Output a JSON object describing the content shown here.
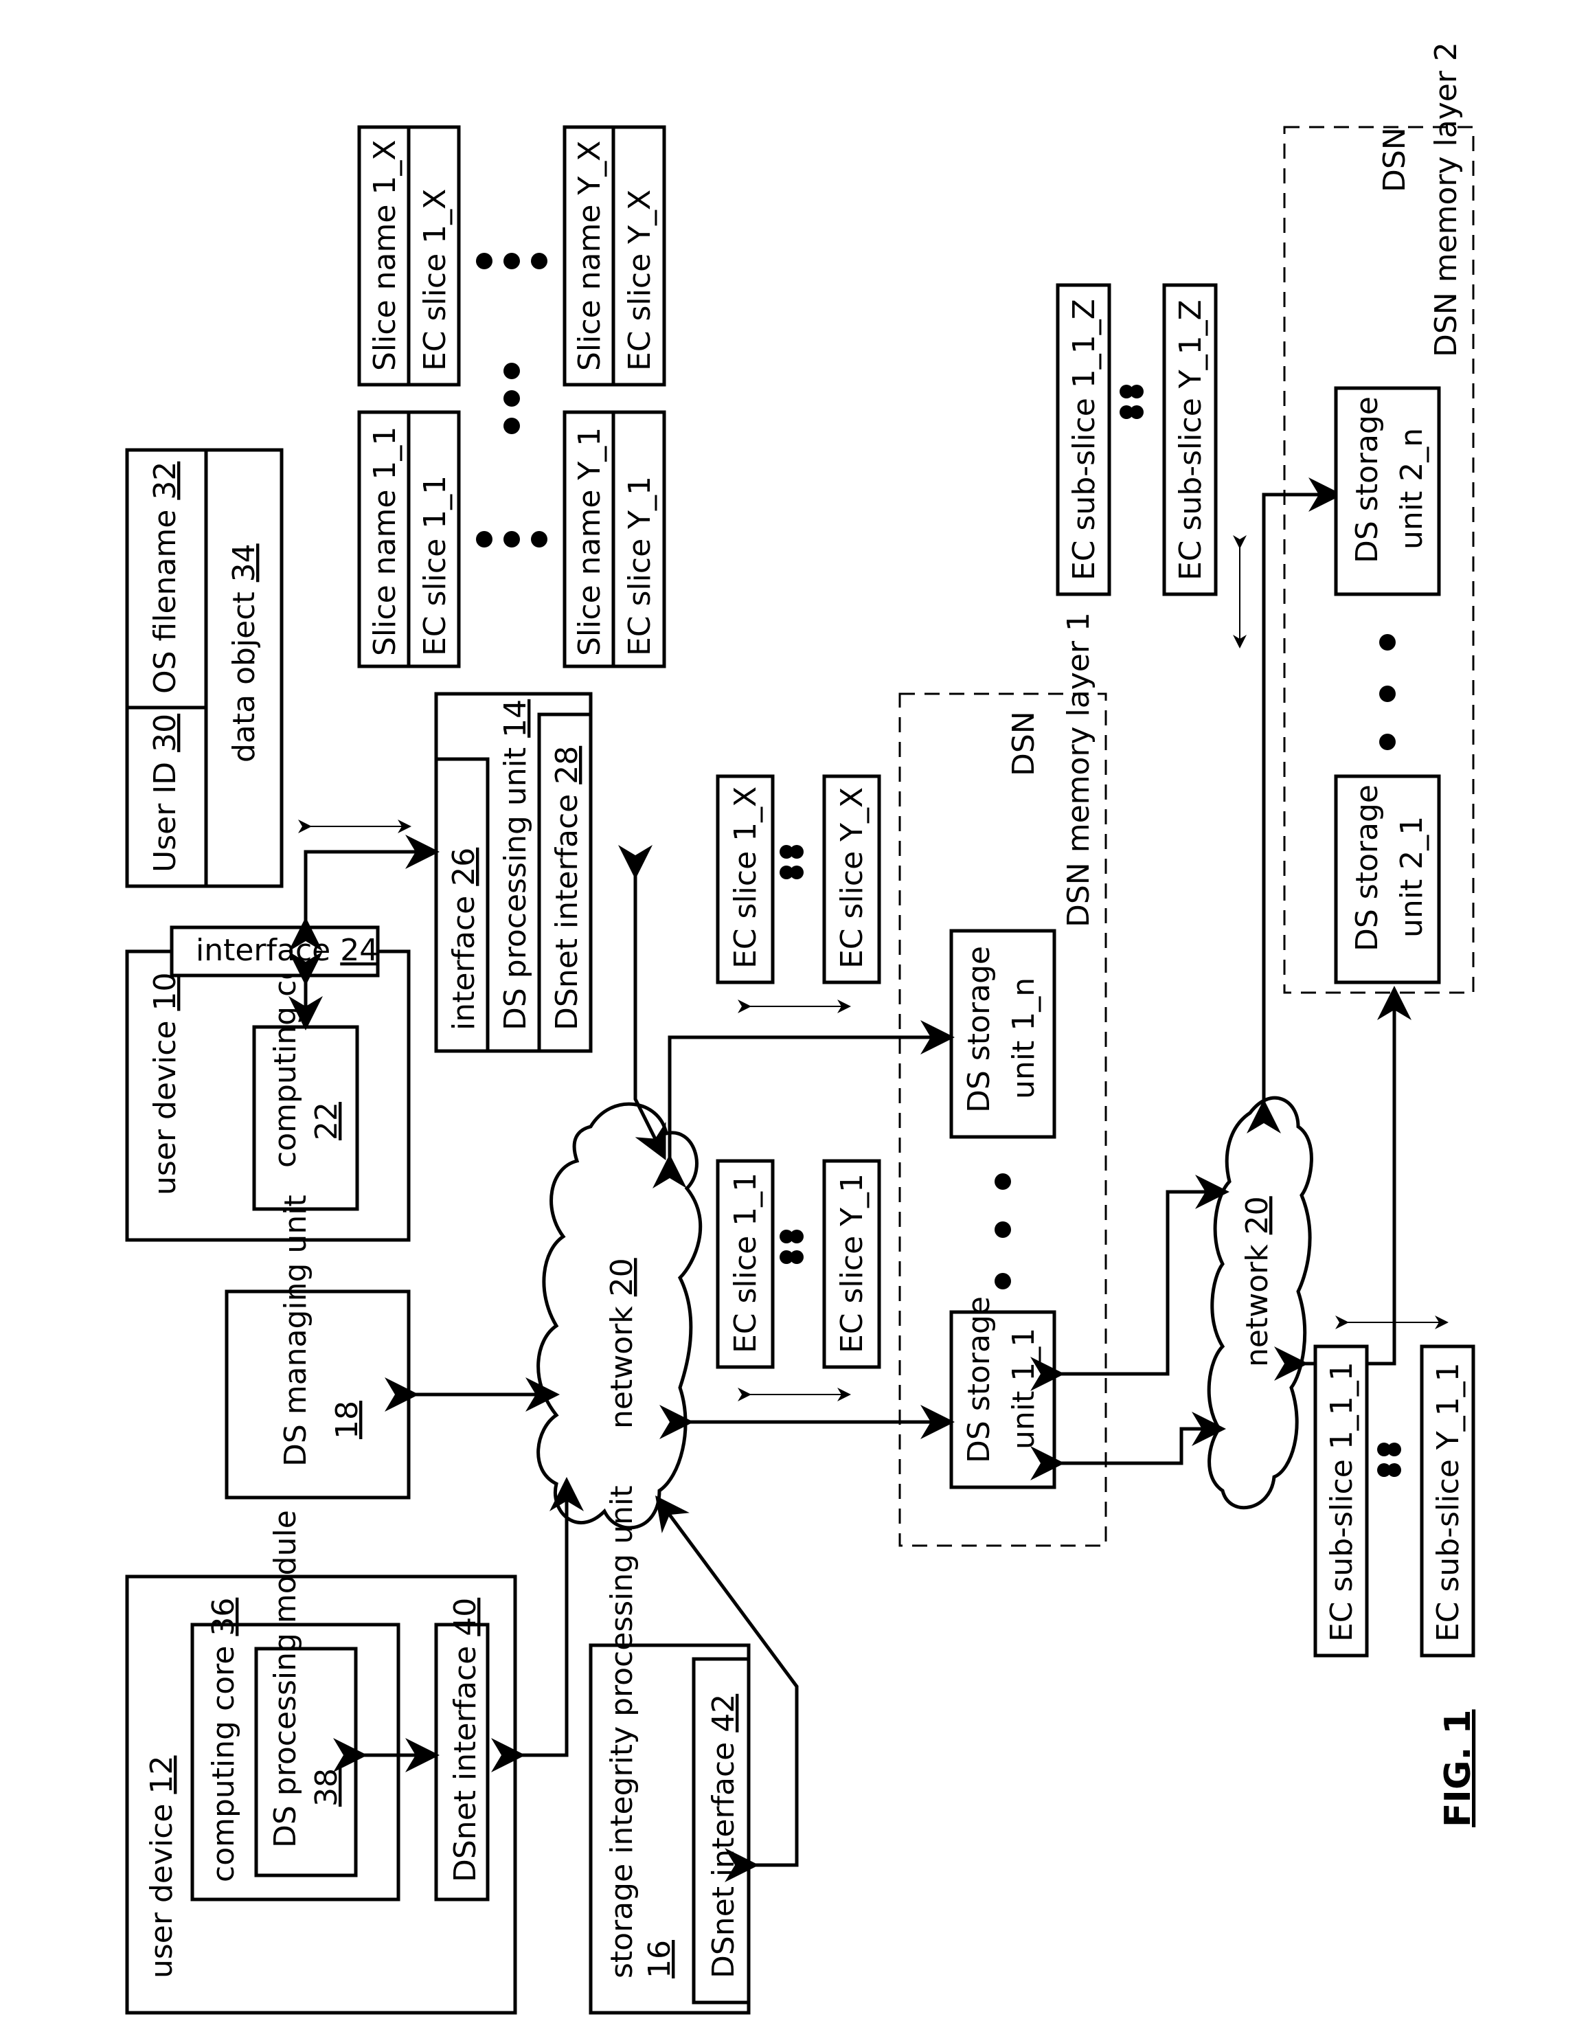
{
  "figure_label": "FIG. 1",
  "nodes": {
    "user_device_10": {
      "label": "user device",
      "ref": "10"
    },
    "computing_core_22": {
      "label": "computing core",
      "ref": "22"
    },
    "interface_24": {
      "label": "interface",
      "ref": "24"
    },
    "ds_managing_unit_18": {
      "label": "DS managing unit",
      "ref": "18"
    },
    "user_device_12": {
      "label": "user device",
      "ref": "12"
    },
    "computing_core_36": {
      "label": "computing core",
      "ref": "36"
    },
    "ds_processing_module_38": {
      "label": "DS processing module",
      "ref": "38"
    },
    "dsnet_interface_40": {
      "label": "DSnet interface",
      "ref": "40"
    },
    "storage_integrity_16": {
      "label": "storage integrity processing unit",
      "ref": "16"
    },
    "dsnet_interface_42": {
      "label": "DSnet interface",
      "ref": "42"
    },
    "ds_processing_unit_14": {
      "label": "DS processing unit",
      "ref": "14"
    },
    "interface_26": {
      "label": "interface",
      "ref": "26"
    },
    "dsnet_interface_28": {
      "label": "DSnet interface",
      "ref": "28"
    },
    "network_20_a": {
      "label": "network",
      "ref": "20"
    },
    "network_20_b": {
      "label": "network",
      "ref": "20"
    },
    "ds_storage_1_1": {
      "label": "DS storage unit 1_1"
    },
    "ds_storage_1_n": {
      "label": "DS storage unit 1_n"
    },
    "ds_storage_2_1": {
      "label": "DS storage unit 2_1"
    },
    "ds_storage_2_n": {
      "label": "DS storage unit 2_n"
    },
    "dsn_layer_1": {
      "label": "DSN memory layer 1"
    },
    "dsn_layer_2": {
      "label": "DSN memory layer 2"
    }
  },
  "data_object_table": {
    "user_id": {
      "label": "User ID",
      "ref": "30"
    },
    "os_filename": {
      "label": "OS filename",
      "ref": "32"
    },
    "data_object": {
      "label": "data object",
      "ref": "34"
    }
  },
  "slice_tables": [
    {
      "name": "Slice name 1_1",
      "slice": "EC slice 1_1"
    },
    {
      "name": "Slice name 1_X",
      "slice": "EC slice 1_X"
    },
    {
      "name": "Slice name Y_1",
      "slice": "EC slice Y_1"
    },
    {
      "name": "Slice name Y_X",
      "slice": "EC slice Y_X"
    }
  ],
  "ec_slices": {
    "group_1": [
      "EC slice 1_1",
      "EC slice Y_1"
    ],
    "group_n": [
      "EC slice 1_X",
      "EC slice Y_X"
    ]
  },
  "sub_slices": {
    "group_1": [
      "EC sub-slice 1_1_1",
      "EC sub-slice Y_1_1"
    ],
    "group_n": [
      "EC sub-slice 1_1_Z",
      "EC sub-slice Y_1_Z"
    ]
  }
}
